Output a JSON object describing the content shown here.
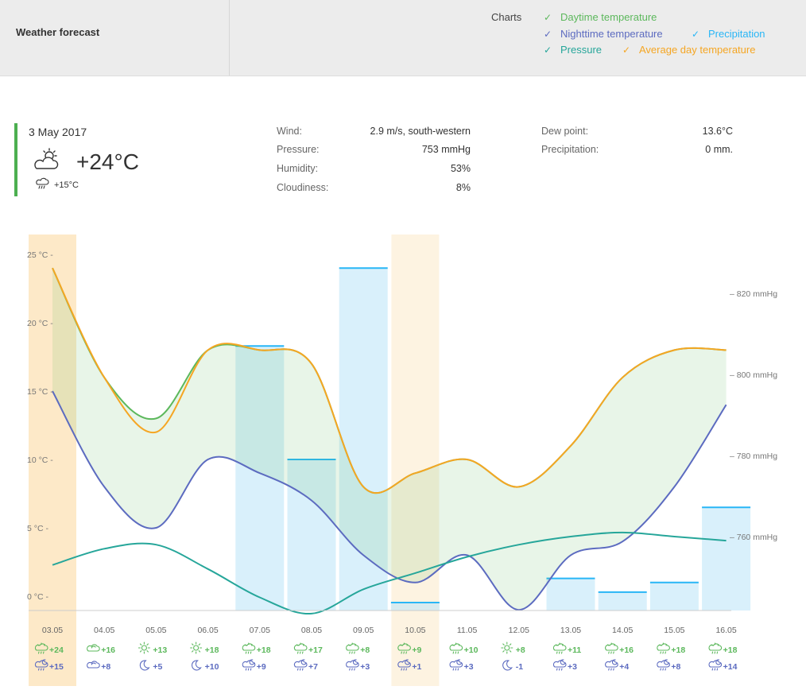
{
  "header": {
    "title": "Weather forecast",
    "charts_label": "Charts",
    "legend": [
      {
        "label": "Daytime temperature",
        "color": "#5cb85c"
      },
      {
        "label": "Nighttime temperature",
        "color": "#5c6bc0"
      },
      {
        "label": "Precipitation",
        "color": "#29b6f6"
      },
      {
        "label": "Pressure",
        "color": "#26a69a"
      },
      {
        "label": "Average day temperature",
        "color": "#f5a623"
      }
    ],
    "check_glyph": "✓"
  },
  "current": {
    "date": "3 May 2017",
    "temp": "+24°C",
    "night_temp": "+15°C",
    "icon": "partly-cloudy-sun-icon",
    "night_icon": "cloud-rain-icon",
    "accent": "#4caf50",
    "details_left": [
      {
        "label": "Wind:",
        "value": "2.9 m/s, south-western"
      },
      {
        "label": "Pressure:",
        "value": "753 mmHg"
      },
      {
        "label": "Humidity:",
        "value": "53%"
      },
      {
        "label": "Cloudiness:",
        "value": "8%"
      }
    ],
    "details_right": [
      {
        "label": "Dew point:",
        "value": "13.6°C"
      },
      {
        "label": "Precipitation:",
        "value": "0 mm."
      }
    ]
  },
  "chart_data": {
    "type": "line",
    "categories": [
      "03.05",
      "04.05",
      "05.05",
      "06.05",
      "07.05",
      "08.05",
      "09.05",
      "10.05",
      "11.05",
      "12.05",
      "13.05",
      "14.05",
      "15.05",
      "16.05"
    ],
    "y_ticks_left": [
      "0 °C",
      "5 °C",
      "10 °C",
      "15 °C",
      "20 °C",
      "25 °C"
    ],
    "y_range_left": [
      -0.5,
      25
    ],
    "y_ticks_right": [
      "760 mmHg",
      "780 mmHg",
      "800 mmHg",
      "820 mmHg"
    ],
    "y_range_right": [
      740,
      830
    ],
    "highlighted": [
      "03.05",
      "10.05"
    ],
    "series": [
      {
        "name": "Daytime temperature",
        "color": "#5cb85c",
        "values": [
          24,
          16,
          13,
          18,
          18,
          17,
          8,
          9,
          10,
          8,
          11,
          16,
          18,
          18
        ]
      },
      {
        "name": "Nighttime temperature",
        "color": "#5c6bc0",
        "values": [
          15,
          8,
          5,
          10,
          9,
          7,
          3,
          1,
          3,
          -1,
          3,
          4,
          8,
          14
        ]
      },
      {
        "name": "Average day temperature",
        "color": "#f5a623",
        "values": [
          24,
          16,
          12,
          18,
          18,
          17,
          8,
          9,
          10,
          8,
          11,
          16,
          18,
          18
        ]
      },
      {
        "name": "Pressure",
        "color": "#26a69a",
        "values": [
          753,
          757,
          758,
          752,
          745,
          741,
          747,
          751,
          755,
          758,
          760,
          761,
          760,
          759
        ]
      },
      {
        "name": "Precipitation",
        "color": "#29b6f6",
        "values": [
          0,
          0,
          0,
          0,
          18.3,
          10,
          24,
          -0.4,
          0,
          0,
          1.3,
          0.3,
          1,
          6.5
        ]
      }
    ],
    "day_labels": [
      "+24",
      "+16",
      "+13",
      "+18",
      "+18",
      "+17",
      "+8",
      "+9",
      "+10",
      "+8",
      "+11",
      "+16",
      "+18",
      "+18"
    ],
    "night_labels": [
      "+15",
      "+8",
      "+5",
      "+10",
      "+9",
      "+7",
      "+3",
      "+1",
      "+3",
      "-1",
      "+3",
      "+4",
      "+8",
      "+14"
    ],
    "day_icons": [
      "cloud-sun-rain-icon",
      "cloud-icon",
      "sun-icon",
      "sun-icon",
      "cloud-sun-rain-icon",
      "cloud-sun-rain-icon",
      "cloud-sun-rain-icon",
      "cloud-sun-rain-icon",
      "cloud-sun-rain-icon",
      "sun-icon",
      "cloud-sun-rain-icon",
      "cloud-sun-rain-icon",
      "cloud-sun-rain-icon",
      "cloud-sun-rain-icon"
    ],
    "night_icons": [
      "cloud-moon-rain-icon",
      "cloud-icon",
      "moon-icon",
      "moon-icon",
      "cloud-moon-rain-icon",
      "cloud-moon-rain-icon",
      "cloud-moon-rain-icon",
      "cloud-moon-rain-icon",
      "cloud-moon-rain-icon",
      "moon-icon",
      "cloud-moon-rain-icon",
      "cloud-moon-rain-icon",
      "cloud-moon-rain-icon",
      "cloud-moon-rain-icon"
    ]
  }
}
